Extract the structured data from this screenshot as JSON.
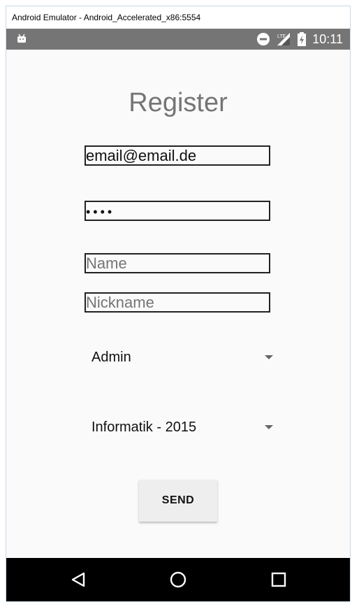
{
  "window": {
    "title": "Android Emulator - Android_Accelerated_x86:5554"
  },
  "status_bar": {
    "time": "10:11",
    "network_label": "LTE",
    "icons": [
      "android-icon",
      "do-not-disturb-icon",
      "lte-signal-icon",
      "battery-charging-icon"
    ]
  },
  "page": {
    "title": "Register",
    "email": {
      "value": "email@email.de"
    },
    "password": {
      "value": "••••"
    },
    "name": {
      "value": "",
      "placeholder": "Name"
    },
    "nickname": {
      "value": "",
      "placeholder": "Nickname"
    },
    "role_spinner": {
      "selected": "Admin"
    },
    "course_spinner": {
      "selected": "Informatik - 2015"
    },
    "send_label": "SEND"
  },
  "nav_bar": {
    "icons": [
      "back-icon",
      "home-icon",
      "recents-icon"
    ]
  }
}
